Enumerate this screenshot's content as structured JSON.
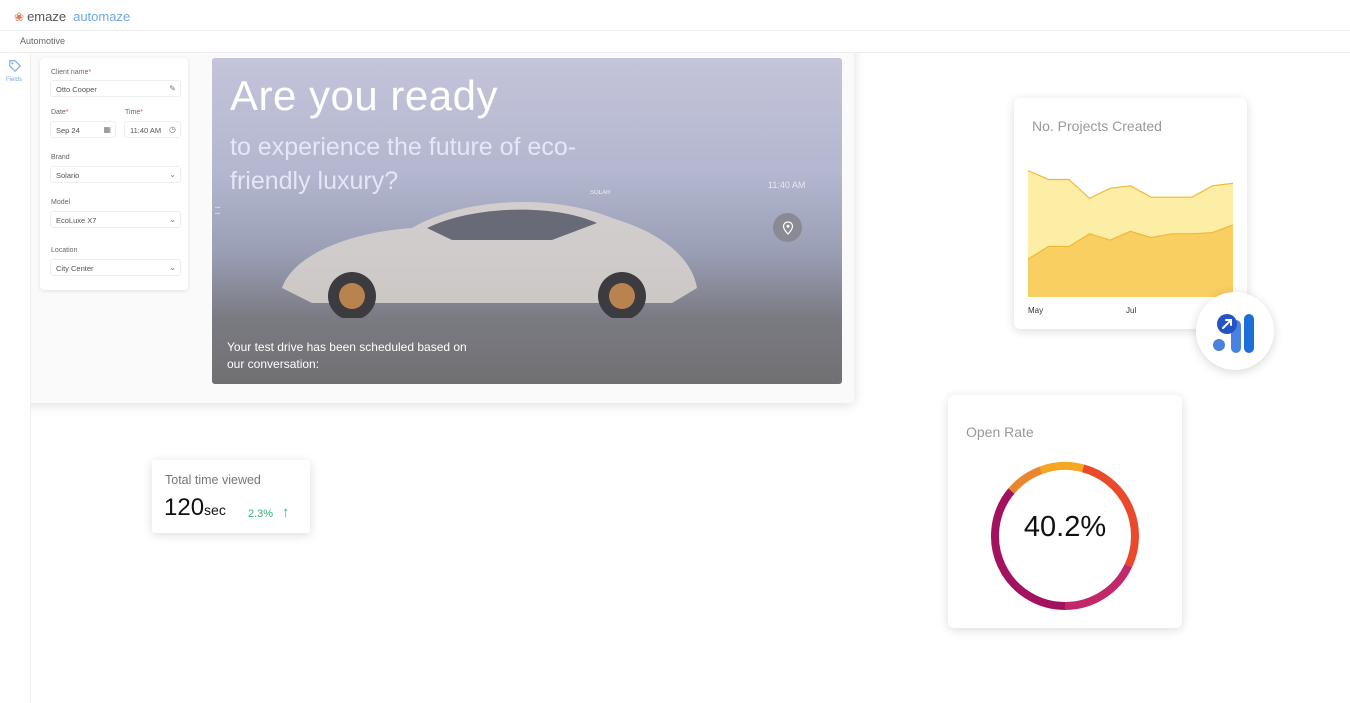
{
  "app": {
    "brand": "emaze",
    "product": "automaze",
    "breadcrumb": "Automotive",
    "rail_label": "Fields"
  },
  "form": {
    "client_name_label": "Client name",
    "client_name_value": "Otto Cooper",
    "date_label": "Date",
    "date_value": "Sep 24",
    "time_label": "Time",
    "time_value": "11:40 AM",
    "brand_label": "Brand",
    "brand_value": "Solario",
    "model_label": "Model",
    "model_value": "EcoLuxe X7",
    "location_label": "Location",
    "location_value": "City Center",
    "required_mark": "*"
  },
  "hero": {
    "headline": "Are you ready",
    "subheadline": "to experience the future of eco-friendly luxury?",
    "side_time": "11:40 AM",
    "message": "Your test drive has been scheduled based on our conversation:",
    "brandmark": "SOLAR"
  },
  "projects": {
    "title": "No. Projects Created"
  },
  "chart_data": {
    "type": "area",
    "title": "No. Projects Created",
    "categories": [
      "May",
      "",
      "Jul",
      ""
    ],
    "x_tick_labels": [
      "May",
      "Jul"
    ],
    "series": [
      {
        "values": [
          100,
          93,
          93,
          78,
          86,
          88,
          79,
          79,
          79,
          88,
          90
        ]
      },
      {
        "values": [
          30,
          40,
          40,
          50,
          45,
          52,
          47,
          50,
          50,
          51,
          57
        ]
      }
    ],
    "colors": [
      "#fdeea6",
      "#f8cf60"
    ],
    "grid": false,
    "legend": "none"
  },
  "open_rate": {
    "title": "Open Rate",
    "value": "40.2%",
    "colors": [
      "#e8872e",
      "#f5a623",
      "#e94a2c",
      "#c0286a",
      "#a3125e"
    ]
  },
  "time_viewed": {
    "title": "Total time viewed",
    "value": "120",
    "unit": "sec",
    "delta": "2.3%"
  },
  "icons": {
    "tag": "tag-icon",
    "edit": "edit-icon",
    "calendar": "calendar-icon",
    "clock": "clock-icon",
    "chevron": "chevron-down-icon",
    "pin": "location-pin-icon",
    "analytics": "analytics-icon",
    "arrow_up": "arrow-up-icon"
  }
}
